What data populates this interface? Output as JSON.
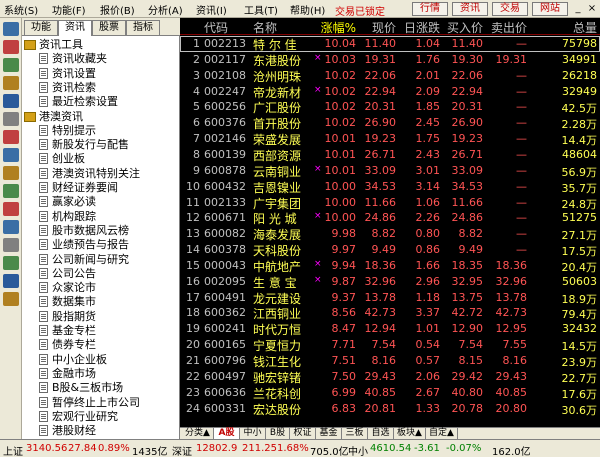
{
  "menu": {
    "items": [
      "系统(S)",
      "功能(F)",
      "报价(B)",
      "分析(A)",
      "资讯(I)",
      "工具(T)",
      "帮助(H)"
    ],
    "lock_status": "交易已锁定",
    "buttons": [
      "行情",
      "资讯",
      "交易",
      "网站"
    ],
    "window_controls": [
      "_",
      "□",
      "×"
    ]
  },
  "left_tabs": [
    "功能",
    "资讯",
    "股票",
    "指标"
  ],
  "tree": [
    {
      "type": "section",
      "label": "资讯工具"
    },
    {
      "type": "item",
      "label": "资讯收藏夹"
    },
    {
      "type": "item",
      "label": "资讯设置"
    },
    {
      "type": "item",
      "label": "资讯检索"
    },
    {
      "type": "item",
      "label": "最近检索设置"
    },
    {
      "type": "section",
      "label": "港澳资讯"
    },
    {
      "type": "item",
      "label": "特别提示"
    },
    {
      "type": "item",
      "label": "新股发行与配售"
    },
    {
      "type": "item",
      "label": "创业板"
    },
    {
      "type": "item",
      "label": "港澳资讯特别关注"
    },
    {
      "type": "item",
      "label": "财经证券要闻"
    },
    {
      "type": "item",
      "label": "赢家必读"
    },
    {
      "type": "item",
      "label": "机构跟踪"
    },
    {
      "type": "item",
      "label": "股市数据风云榜"
    },
    {
      "type": "item",
      "label": "业绩预告与报告"
    },
    {
      "type": "item",
      "label": "公司新闻与研究"
    },
    {
      "type": "item",
      "label": "公司公告"
    },
    {
      "type": "item",
      "label": "众家论市"
    },
    {
      "type": "item",
      "label": "数据集市"
    },
    {
      "type": "item",
      "label": "股指期货"
    },
    {
      "type": "item",
      "label": "基金专栏"
    },
    {
      "type": "item",
      "label": "债券专栏"
    },
    {
      "type": "item",
      "label": "中小企业板"
    },
    {
      "type": "item",
      "label": "金融市场"
    },
    {
      "type": "item",
      "label": "B股&三板市场"
    },
    {
      "type": "item",
      "label": "暂停终止上市公司"
    },
    {
      "type": "item",
      "label": "宏观行业研究"
    },
    {
      "type": "item",
      "label": "港股财经"
    }
  ],
  "table": {
    "headers": [
      "代码",
      "名称",
      "涨幅%",
      "现价",
      "日涨跌",
      "买入价",
      "卖出价",
      "总量"
    ],
    "rows": [
      {
        "idx": "1",
        "code": "002213",
        "name": "特 尔 佳",
        "mark": "",
        "pct": "10.04",
        "price": "11.40",
        "chg": "1.04",
        "bid": "11.40",
        "ask": "—",
        "vol": "75798"
      },
      {
        "idx": "2",
        "code": "002117",
        "name": "东港股份",
        "mark": "×",
        "pct": "10.03",
        "price": "19.31",
        "chg": "1.76",
        "bid": "19.30",
        "ask": "19.31",
        "vol": "34991"
      },
      {
        "idx": "3",
        "code": "002108",
        "name": "沧州明珠",
        "mark": "",
        "pct": "10.02",
        "price": "22.06",
        "chg": "2.01",
        "bid": "22.06",
        "ask": "—",
        "vol": "26218"
      },
      {
        "idx": "4",
        "code": "002247",
        "name": "帝龙新材",
        "mark": "×",
        "pct": "10.02",
        "price": "22.94",
        "chg": "2.09",
        "bid": "22.94",
        "ask": "—",
        "vol": "32949"
      },
      {
        "idx": "5",
        "code": "600256",
        "name": "广汇股份",
        "mark": "",
        "pct": "10.02",
        "price": "20.31",
        "chg": "1.85",
        "bid": "20.31",
        "ask": "—",
        "vol": "42.5万"
      },
      {
        "idx": "6",
        "code": "600376",
        "name": "首开股份",
        "mark": "",
        "pct": "10.02",
        "price": "26.90",
        "chg": "2.45",
        "bid": "26.90",
        "ask": "—",
        "vol": "2.28万"
      },
      {
        "idx": "7",
        "code": "002146",
        "name": "荣盛发展",
        "mark": "",
        "pct": "10.01",
        "price": "19.23",
        "chg": "1.75",
        "bid": "19.23",
        "ask": "—",
        "vol": "14.4万"
      },
      {
        "idx": "8",
        "code": "600139",
        "name": "西部资源",
        "mark": "",
        "pct": "10.01",
        "price": "26.71",
        "chg": "2.43",
        "bid": "26.71",
        "ask": "—",
        "vol": "48604"
      },
      {
        "idx": "9",
        "code": "600878",
        "name": "云南铜业",
        "mark": "×",
        "pct": "10.01",
        "price": "33.09",
        "chg": "3.01",
        "bid": "33.09",
        "ask": "—",
        "vol": "56.9万"
      },
      {
        "idx": "10",
        "code": "600432",
        "name": "吉恩镍业",
        "mark": "",
        "pct": "10.00",
        "price": "34.53",
        "chg": "3.14",
        "bid": "34.53",
        "ask": "—",
        "vol": "35.7万"
      },
      {
        "idx": "11",
        "code": "002133",
        "name": "广宇集团",
        "mark": "",
        "pct": "10.00",
        "price": "11.66",
        "chg": "1.06",
        "bid": "11.66",
        "ask": "—",
        "vol": "24.8万"
      },
      {
        "idx": "12",
        "code": "600671",
        "name": "阳 光 城",
        "mark": "×",
        "pct": "10.00",
        "price": "24.86",
        "chg": "2.26",
        "bid": "24.86",
        "ask": "—",
        "vol": "51275"
      },
      {
        "idx": "13",
        "code": "600082",
        "name": "海泰发展",
        "mark": "",
        "pct": "9.98",
        "price": "8.82",
        "chg": "0.80",
        "bid": "8.82",
        "ask": "—",
        "vol": "27.1万"
      },
      {
        "idx": "14",
        "code": "600378",
        "name": "天科股份",
        "mark": "",
        "pct": "9.97",
        "price": "9.49",
        "chg": "0.86",
        "bid": "9.49",
        "ask": "—",
        "vol": "17.5万"
      },
      {
        "idx": "15",
        "code": "000043",
        "name": "中航地产",
        "mark": "×",
        "pct": "9.94",
        "price": "18.36",
        "chg": "1.66",
        "bid": "18.35",
        "ask": "18.36",
        "vol": "20.4万"
      },
      {
        "idx": "16",
        "code": "002095",
        "name": "生 意 宝",
        "mark": "×",
        "pct": "9.87",
        "price": "32.96",
        "chg": "2.96",
        "bid": "32.95",
        "ask": "32.96",
        "vol": "50603"
      },
      {
        "idx": "17",
        "code": "600491",
        "name": "龙元建设",
        "mark": "",
        "pct": "9.37",
        "price": "13.78",
        "chg": "1.18",
        "bid": "13.75",
        "ask": "13.78",
        "vol": "18.9万"
      },
      {
        "idx": "18",
        "code": "600362",
        "name": "江西铜业",
        "mark": "",
        "pct": "8.56",
        "price": "42.73",
        "chg": "3.37",
        "bid": "42.72",
        "ask": "42.73",
        "vol": "79.4万"
      },
      {
        "idx": "19",
        "code": "600241",
        "name": "时代万恒",
        "mark": "",
        "pct": "8.47",
        "price": "12.94",
        "chg": "1.01",
        "bid": "12.90",
        "ask": "12.95",
        "vol": "32432"
      },
      {
        "idx": "20",
        "code": "600165",
        "name": "宁夏恒力",
        "mark": "",
        "pct": "7.71",
        "price": "7.54",
        "chg": "0.54",
        "bid": "7.54",
        "ask": "7.55",
        "vol": "14.5万"
      },
      {
        "idx": "21",
        "code": "600796",
        "name": "钱江生化",
        "mark": "",
        "pct": "7.51",
        "price": "8.16",
        "chg": "0.57",
        "bid": "8.15",
        "ask": "8.16",
        "vol": "23.9万"
      },
      {
        "idx": "22",
        "code": "600497",
        "name": "驰宏锌锗",
        "mark": "",
        "pct": "7.50",
        "price": "29.43",
        "chg": "2.06",
        "bid": "29.42",
        "ask": "29.43",
        "vol": "22.7万"
      },
      {
        "idx": "23",
        "code": "600636",
        "name": "兰花科创",
        "mark": "",
        "pct": "6.99",
        "price": "40.85",
        "chg": "2.67",
        "bid": "40.80",
        "ask": "40.85",
        "vol": "17.6万"
      },
      {
        "idx": "24",
        "code": "600331",
        "name": "宏达股份",
        "mark": "",
        "pct": "6.83",
        "price": "20.81",
        "chg": "1.33",
        "bid": "20.78",
        "ask": "20.80",
        "vol": "30.6万"
      }
    ]
  },
  "sheet_tabs": [
    "分类▲",
    "A股",
    "中小",
    "B股",
    "权证",
    "基金",
    "三板",
    "自选",
    "板块▲",
    "自定▲"
  ],
  "status": {
    "sh_label": "上证",
    "sh_index": "3140.56",
    "sh_change": "27.84",
    "sh_pct": "0.89%",
    "sh_amount": "1435亿",
    "sz_label": "深证",
    "sz_index": "12802.9",
    "sz_change": "211.25",
    "sz_pct": "1.68%",
    "sz_amount": "705.0亿",
    "sme_label": "中小",
    "sme_index": "4610.54",
    "sme_change": "-3.61",
    "sme_pct": "-0.07%",
    "sme_amount": "162.0亿"
  },
  "colors": {
    "up": "#ff5454",
    "name": "#ffff54",
    "header": "#c0c0c0",
    "mark": "#ff00ff",
    "panel_bg": "#ece9d8"
  }
}
